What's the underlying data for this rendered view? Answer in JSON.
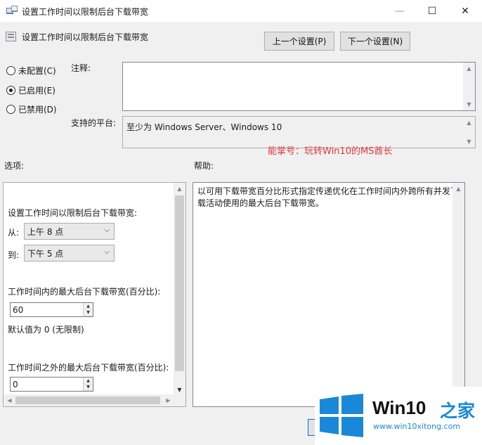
{
  "window": {
    "title": "设置工作时间以限制后台下载带宽",
    "minimize": "—",
    "maximize": "☐",
    "close": "✕"
  },
  "header": {
    "title": "设置工作时间以限制后台下载带宽",
    "prev_button": "上一个设置(P)",
    "next_button": "下一个设置(N)"
  },
  "state": {
    "options": [
      {
        "label": "未配置(C)",
        "checked": false
      },
      {
        "label": "已启用(E)",
        "checked": true
      },
      {
        "label": "已禁用(D)",
        "checked": false
      }
    ]
  },
  "comment": {
    "label": "注释:",
    "value": ""
  },
  "platform": {
    "label": "支持的平台:",
    "value": "至少为 Windows Server、Windows 10"
  },
  "watermark_text": "能掌号：玩转Win10的MS酋长",
  "sections": {
    "options_label": "选项:",
    "help_label": "帮助:"
  },
  "options_pane": {
    "heading": "设置工作时间以限制后台下载带宽:",
    "from_label": "从:",
    "from_value": "上午 8 点",
    "to_label": "到:",
    "to_value": "下午 5 点",
    "max_in_label": "工作时间内的最大后台下载带宽(百分比):",
    "max_in_value": "60",
    "default_note": "默认值为 0 (无限制)",
    "max_out_label": "工作时间之外的最大后台下载带宽(百分比):",
    "max_out_value": "0"
  },
  "help_pane": {
    "text": "以可用下载带宽百分比形式指定传递优化在工作时间内外跨所有并发下载活动使用的最大后台下载带宽。"
  },
  "logo": {
    "brand": "Win10",
    "brand_cn": "之家",
    "url": "www.win10xitong.com"
  },
  "colors": {
    "watermark": "#e03a3a",
    "logo_blue": "#1a88d8"
  }
}
